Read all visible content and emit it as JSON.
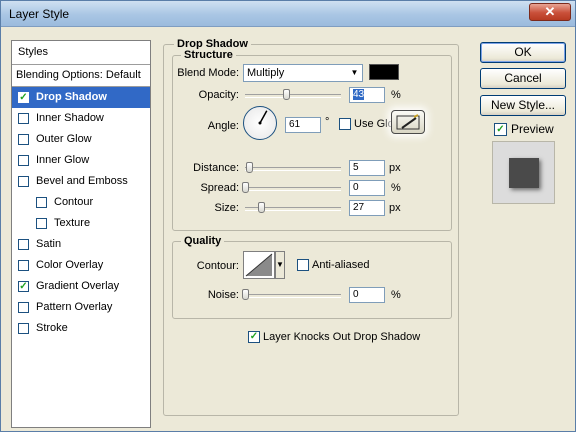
{
  "window": {
    "title": "Layer Style",
    "close_glyph": "✕"
  },
  "styles": {
    "header": "Styles",
    "blending_options": "Blending Options: Default",
    "items": [
      {
        "label": "Drop Shadow",
        "checked": true,
        "selected": true
      },
      {
        "label": "Inner Shadow",
        "checked": false
      },
      {
        "label": "Outer Glow",
        "checked": false
      },
      {
        "label": "Inner Glow",
        "checked": false
      },
      {
        "label": "Bevel and Emboss",
        "checked": false
      },
      {
        "label": "Contour",
        "checked": false,
        "sub": true
      },
      {
        "label": "Texture",
        "checked": false,
        "sub": true
      },
      {
        "label": "Satin",
        "checked": false
      },
      {
        "label": "Color Overlay",
        "checked": false
      },
      {
        "label": "Gradient Overlay",
        "checked": true
      },
      {
        "label": "Pattern Overlay",
        "checked": false
      },
      {
        "label": "Stroke",
        "checked": false
      }
    ]
  },
  "drop_shadow": {
    "section_title": "Drop Shadow",
    "structure": {
      "title": "Structure",
      "blend_mode_label": "Blend Mode:",
      "blend_mode_value": "Multiply",
      "shadow_color": "#000000",
      "opacity_label": "Opacity:",
      "opacity_value": "43",
      "opacity_unit": "%",
      "angle_label": "Angle:",
      "angle_value": "61",
      "angle_unit": "°",
      "use_global_label": "Use Glo",
      "use_global_checked": false,
      "distance_label": "Distance:",
      "distance_value": "5",
      "distance_unit": "px",
      "spread_label": "Spread:",
      "spread_value": "0",
      "spread_unit": "%",
      "size_label": "Size:",
      "size_value": "27",
      "size_unit": "px"
    },
    "quality": {
      "title": "Quality",
      "contour_label": "Contour:",
      "anti_aliased_label": "Anti-aliased",
      "anti_aliased_checked": false,
      "noise_label": "Noise:",
      "noise_value": "0",
      "noise_unit": "%"
    },
    "knockout_label": "Layer Knocks Out Drop Shadow",
    "knockout_checked": true
  },
  "buttons": {
    "ok": "OK",
    "cancel": "Cancel",
    "new_style": "New Style...",
    "preview_label": "Preview",
    "preview_checked": true
  },
  "check_glyph": "✓",
  "dropdown_glyph": "▼"
}
